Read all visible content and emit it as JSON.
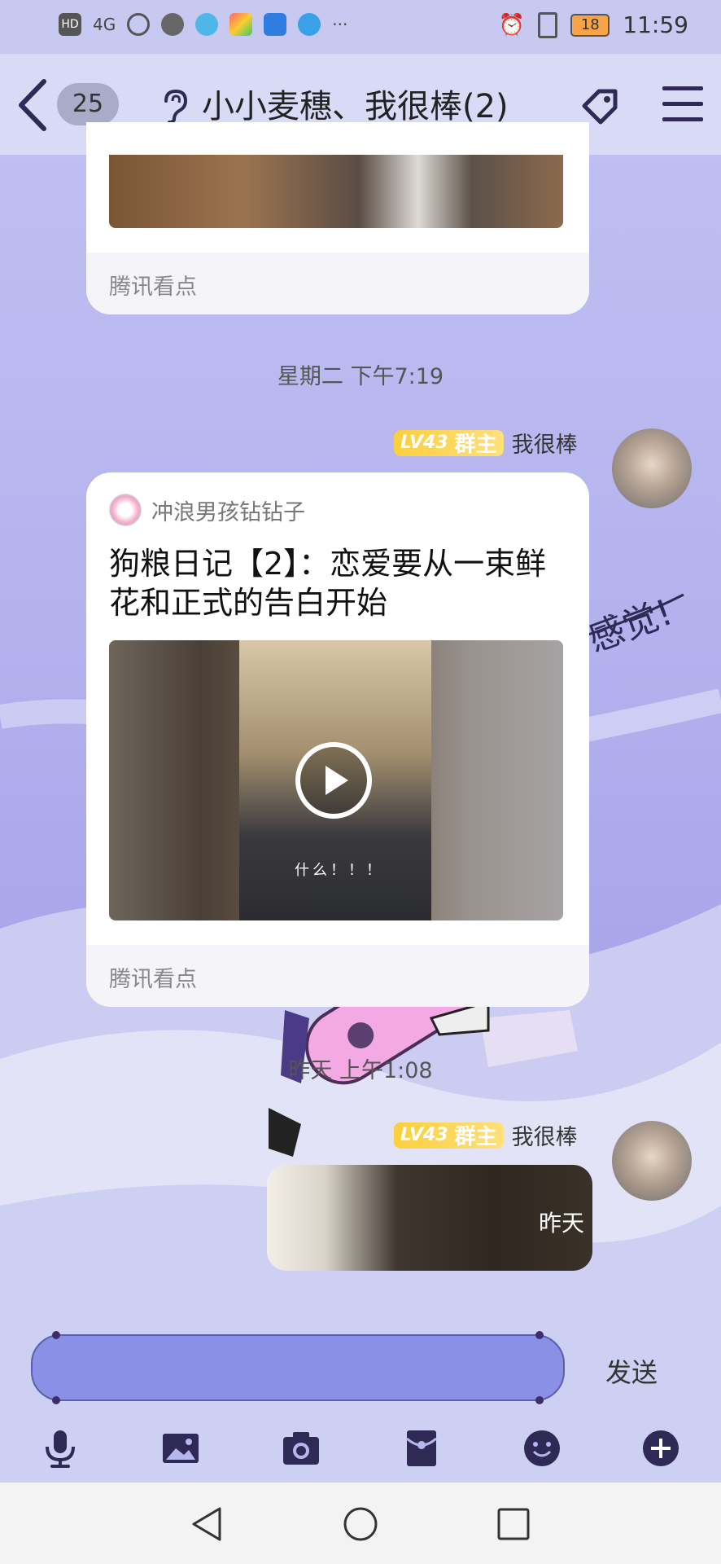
{
  "status_bar": {
    "time": "11:59",
    "battery": "18",
    "network": "4G"
  },
  "header": {
    "unread_count": "25",
    "title": "小小麦穗、我很棒(2)"
  },
  "messages": {
    "card1": {
      "source": "腾讯看点"
    },
    "timestamp1": "星期二 下午7:19",
    "sender1": {
      "level": "LV43",
      "role": "群主",
      "name": "我很棒"
    },
    "card2": {
      "author": "冲浪男孩钻钻子",
      "title": "狗粮日记【2】：恋爱要从一束鲜花和正式的告白开始",
      "video_caption": "什么！！！",
      "source": "腾讯看点"
    },
    "timestamp2": "昨天 上午1:08",
    "sender2": {
      "level": "LV43",
      "role": "群主",
      "name": "我很棒"
    },
    "photo_message": {
      "label": "昨天"
    }
  },
  "input": {
    "send_label": "发送"
  },
  "toolbar": {
    "items": [
      "microphone-icon",
      "image-icon",
      "camera-icon",
      "red-packet-icon",
      "emoji-icon",
      "plus-icon"
    ]
  },
  "navbar": {
    "items": [
      "back-triangle-icon",
      "home-circle-icon",
      "recent-square-icon"
    ]
  },
  "colors": {
    "accent": "#8a90e6",
    "header_bg": "#dcdef6",
    "level_badge": "#fbcf3c"
  }
}
